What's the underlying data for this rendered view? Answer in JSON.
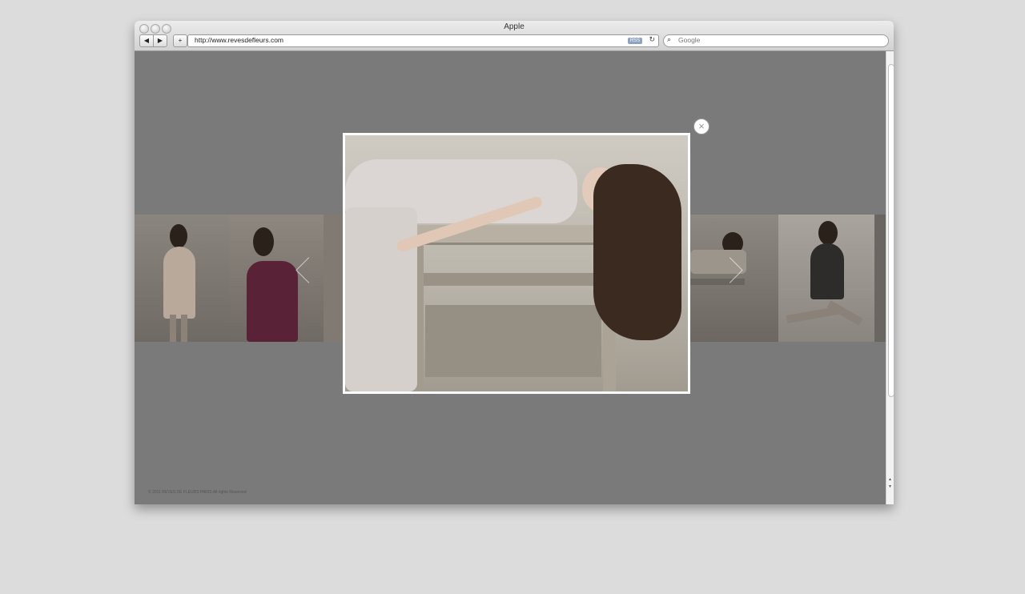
{
  "browser": {
    "title": "Apple",
    "back_label": "◀",
    "forward_label": "▶",
    "add_label": "+",
    "url": "http://www.revesdefleurs.com",
    "rss_label": "RSS",
    "reload_label": "↻",
    "search_placeholder": "Google"
  },
  "page": {
    "footer_text": "© 2011 REVES DE FLEURS PARIS All rights Reserved"
  },
  "lightbox": {
    "close_label": "×"
  }
}
